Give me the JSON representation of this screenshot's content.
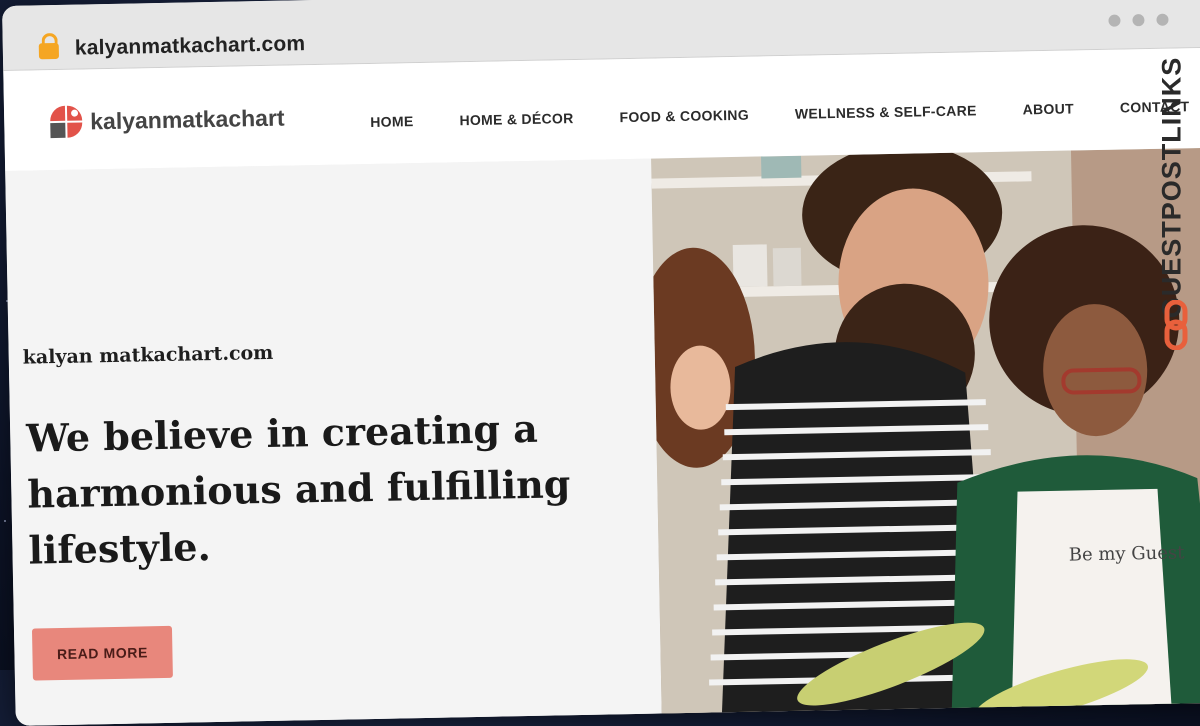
{
  "browser": {
    "url": "kalyanmatkachart.com"
  },
  "site": {
    "logo_text": "kalyanmatkachart",
    "nav": [
      {
        "label": "HOME"
      },
      {
        "label": "HOME & DÉCOR"
      },
      {
        "label": "FOOD & COOKING"
      },
      {
        "label": "WELLNESS & SELF-CARE"
      },
      {
        "label": "ABOUT"
      },
      {
        "label": "CONTACT"
      }
    ]
  },
  "hero": {
    "eyebrow": "kalyan matkachart.com",
    "headline": "We believe in creating a harmonious and fulfilling lifestyle.",
    "button_label": "READ MORE",
    "image_text": "Be my Guest"
  },
  "watermark": {
    "text": "GUESTPOSTLINKS"
  },
  "colors": {
    "accent": "#e8877c",
    "logo_red": "#e2534a",
    "background": "#0d1428"
  }
}
